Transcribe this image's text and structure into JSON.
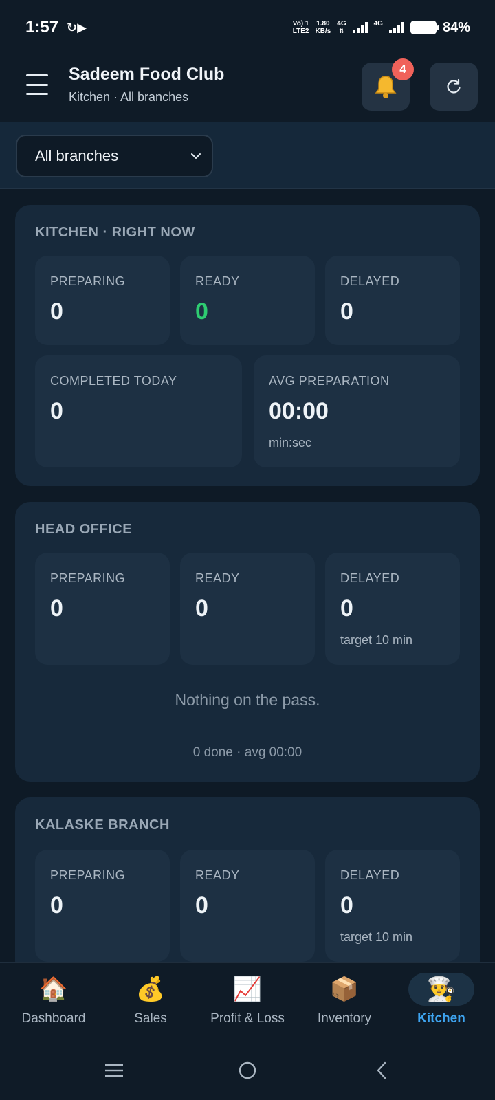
{
  "status_bar": {
    "time": "1:57",
    "volte_top": "Vo) 1",
    "volte_bottom": "LTE2",
    "speed_value": "1.80",
    "speed_unit": "KB/s",
    "net1": "4G",
    "net2": "4G",
    "battery": "84%"
  },
  "header": {
    "title": "Sadeem Food Club",
    "subtitle": "Kitchen · All branches",
    "notification_count": "4"
  },
  "filter": {
    "selected_branch": "All branches"
  },
  "kitchen_now": {
    "title": "KITCHEN · RIGHT NOW",
    "preparing_label": "PREPARING",
    "preparing_value": "0",
    "ready_label": "READY",
    "ready_value": "0",
    "delayed_label": "DELAYED",
    "delayed_value": "0",
    "completed_label": "COMPLETED TODAY",
    "completed_value": "0",
    "avg_label": "AVG PREPARATION",
    "avg_value": "00:00",
    "avg_unit": "min:sec"
  },
  "head_office": {
    "title": "HEAD OFFICE",
    "preparing_label": "PREPARING",
    "preparing_value": "0",
    "ready_label": "READY",
    "ready_value": "0",
    "delayed_label": "DELAYED",
    "delayed_value": "0",
    "delayed_target": "target 10 min",
    "empty_message": "Nothing on the pass.",
    "footer": "0 done · avg 00:00"
  },
  "kalaske": {
    "title": "KALASKE BRANCH",
    "preparing_label": "PREPARING",
    "preparing_value": "0",
    "ready_label": "READY",
    "ready_value": "0",
    "delayed_label": "DELAYED",
    "delayed_value": "0",
    "delayed_target": "target 10 min"
  },
  "nav": {
    "items": [
      {
        "label": "Dashboard",
        "icon": "house-icon",
        "glyph": "🏠"
      },
      {
        "label": "Sales",
        "icon": "money-bag-icon",
        "glyph": "💰"
      },
      {
        "label": "Profit & Loss",
        "icon": "chart-up-icon",
        "glyph": "📈"
      },
      {
        "label": "Inventory",
        "icon": "package-icon",
        "glyph": "📦"
      },
      {
        "label": "Kitchen",
        "icon": "chef-icon",
        "glyph": "👨‍🍳"
      }
    ],
    "active": "Kitchen"
  },
  "colors": {
    "accent": "#3ea4f0",
    "ready_green": "#2ecc71",
    "badge_red": "#f0625a",
    "bell_yellow": "#f5b82e"
  }
}
